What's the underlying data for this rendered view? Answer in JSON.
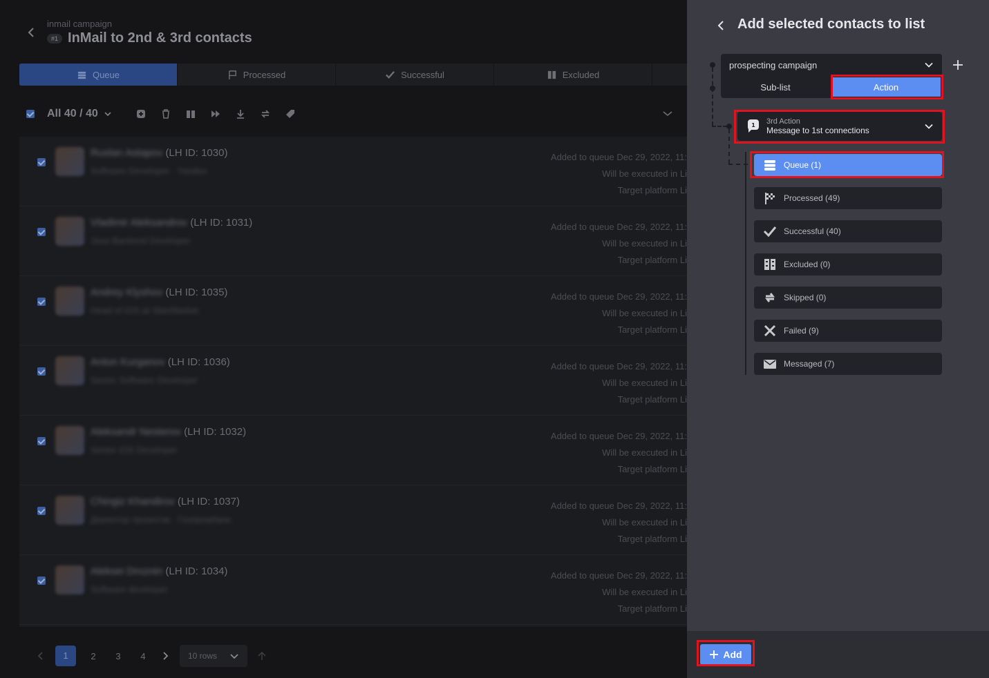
{
  "campaign": {
    "subtitle": "inmail campaign",
    "number_badge": "#1",
    "title": "InMail to 2nd & 3rd contacts"
  },
  "tabs": [
    {
      "label": "Queue",
      "icon": "queue-icon",
      "active": true
    },
    {
      "label": "Processed",
      "icon": "flag-icon",
      "active": false
    },
    {
      "label": "Successful",
      "icon": "check-icon",
      "active": false
    },
    {
      "label": "Excluded",
      "icon": "excluded-icon",
      "active": false
    }
  ],
  "toolbar": {
    "selection_label": "All 40 / 40",
    "actions": [
      "add-icon",
      "delete-icon",
      "exclude-icon",
      "skip-icon",
      "download-icon",
      "sync-icon",
      "tag-icon"
    ]
  },
  "contacts": [
    {
      "name": "Ruslan Astapov",
      "lh_id": "(LH ID: 1030)",
      "role": "Software Developer · Yandex"
    },
    {
      "name": "Vladimir Aleksandrov",
      "lh_id": "(LH ID: 1031)",
      "role": "Java Backend Developer"
    },
    {
      "name": "Andrey Klyshov",
      "lh_id": "(LH ID: 1035)",
      "role": "Head of iOS at SberMarket"
    },
    {
      "name": "Anton Kurganov",
      "lh_id": "(LH ID: 1036)",
      "role": "Senior Software Developer"
    },
    {
      "name": "Aleksandr Nesterov",
      "lh_id": "(LH ID: 1032)",
      "role": "Senior iOS Developer"
    },
    {
      "name": "Chingiz Khandirov",
      "lh_id": "(LH ID: 1037)",
      "role": "Директор проектов · Газпромбанк"
    },
    {
      "name": "Aleksei Droznin",
      "lh_id": "(LH ID: 1034)",
      "role": "Software developer"
    }
  ],
  "contact_meta": {
    "added": "Added to queue Dec 29, 2022, 11:",
    "executed": "Will be executed in Li",
    "platform": "Target platform Li"
  },
  "pagination": {
    "pages": [
      "1",
      "2",
      "3",
      "4"
    ],
    "current": "1",
    "rows_label": "10 rows"
  },
  "panel": {
    "title": "Add selected contacts to list",
    "campaign_select": "prospecting campaign",
    "segment": {
      "sublist": "Sub-list",
      "action": "Action",
      "selected": "Action"
    },
    "action_select": {
      "line1": "3rd Action",
      "line2": "Message to 1st connections"
    },
    "statuses": [
      {
        "label": "Queue (1)",
        "icon": "queue-icon",
        "active": true
      },
      {
        "label": "Processed (49)",
        "icon": "flag-icon",
        "active": false
      },
      {
        "label": "Successful (40)",
        "icon": "check-icon",
        "active": false
      },
      {
        "label": "Excluded (0)",
        "icon": "excluded-icon",
        "active": false
      },
      {
        "label": "Skipped (0)",
        "icon": "skip-arrows-icon",
        "active": false
      },
      {
        "label": "Failed (9)",
        "icon": "x-icon",
        "active": false
      },
      {
        "label": "Messaged (7)",
        "icon": "envelope-icon",
        "active": false
      }
    ],
    "add_button": "Add"
  },
  "colors": {
    "accent": "#5b8ef0",
    "highlight": "#e1131f",
    "panel_bg": "#3b3c43"
  }
}
